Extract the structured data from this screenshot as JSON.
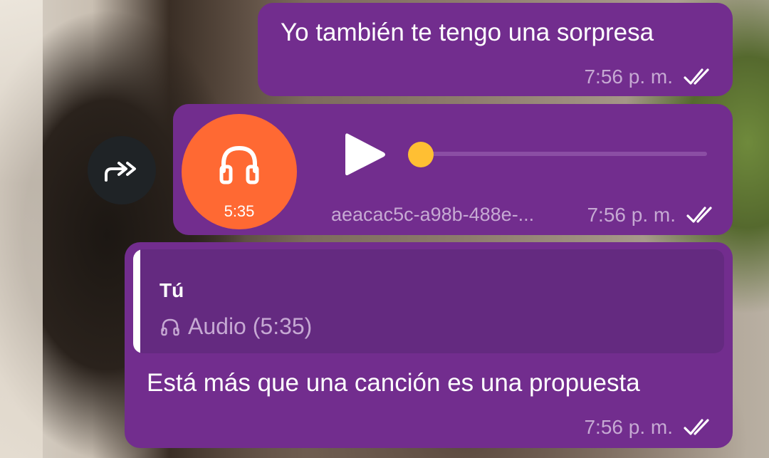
{
  "messages": [
    {
      "text": "Yo también te tengo una sorpresa",
      "time": "7:56 p. m.",
      "status_icon": "double-check-icon"
    },
    {
      "type": "audio",
      "duration": "5:35",
      "file_name": "aeacac5c-a98b-488e-...",
      "time": "7:56 p. m.",
      "status_icon": "double-check-icon",
      "progress": 0.0
    },
    {
      "reply": {
        "author": "Tú",
        "preview": "Audio (5:35)",
        "icon": "headphones-icon"
      },
      "text": "Está más que una canción es una propuesta",
      "time": "7:56 p. m.",
      "status_icon": "double-check-icon"
    }
  ],
  "forward_icon": "forward-share-icon",
  "colors": {
    "bubble": "#722d8e",
    "quote_bg": "#642a80",
    "audio_circle": "#ff6933",
    "seek_knob": "#ffbf33",
    "meta_text": "#c6a9d3"
  }
}
